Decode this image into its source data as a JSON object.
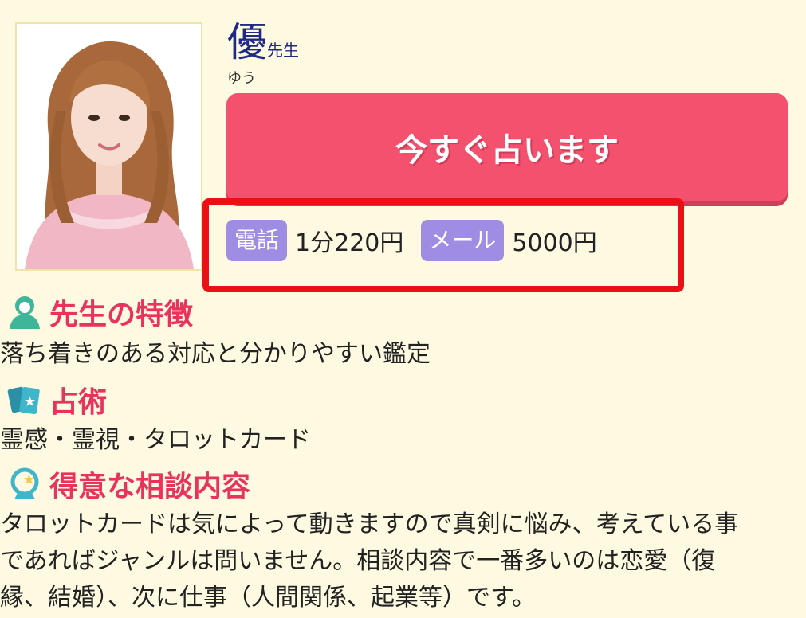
{
  "profile": {
    "photo_alt": "avatar",
    "name": "優",
    "name_suffix": "先生",
    "reading": "ゆう"
  },
  "cta": {
    "label": "今すぐ占います",
    "color": "#f3516e"
  },
  "pricing": {
    "phone_label": "電話",
    "phone_price": "1分220円",
    "mail_label": "メール",
    "mail_price": "5000円",
    "tag_color": "#9f8ce3",
    "highlight_color": "#ec1015"
  },
  "sections": {
    "features": {
      "heading": "先生の特徴",
      "icon": "teacher-icon",
      "text": "落ち着きのある対応と分かりやすい鑑定"
    },
    "divination": {
      "heading": "占術",
      "icon": "tarot-cards-icon",
      "text": "霊感・霊視・タロットカード"
    },
    "specialty": {
      "heading": "得意な相談内容",
      "icon": "crystal-ball-icon",
      "text_line1": "タロットカードは気によって動きますので真剣に悩み、考えている事",
      "text_line2": "であればジャンルは問いません。相談内容で一番多いのは恋愛（復",
      "text_line3": "縁、結婚）、次に仕事（人間関係、起業等）です。"
    }
  },
  "colors": {
    "background": "#fef9e1",
    "heading": "#e9335d",
    "name": "#1e2a86"
  }
}
